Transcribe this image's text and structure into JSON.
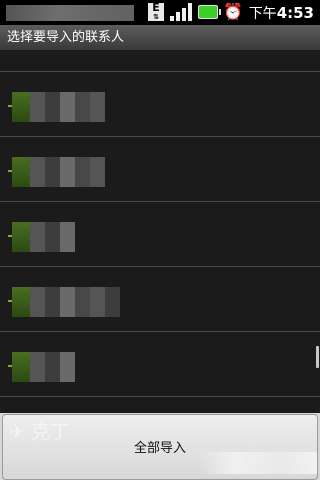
{
  "status_bar": {
    "time_prefix": "下午",
    "time": "4:53",
    "network_letter": "E",
    "icons": [
      "network-e-icon",
      "signal-icon",
      "battery-icon",
      "alarm-icon"
    ]
  },
  "title_bar": {
    "title": "选择要导入的联系人"
  },
  "contacts": [
    {
      "name": "",
      "checked": true
    },
    {
      "name": "",
      "checked": true
    },
    {
      "name": "",
      "checked": true
    },
    {
      "name": "",
      "checked": true
    },
    {
      "name": "",
      "checked": true
    }
  ],
  "bottom": {
    "import_all_label": "全部导入",
    "ghost_text": "✈ 克丁"
  },
  "colors": {
    "check_green": "#6fb13a",
    "battery_green": "#3bd12a",
    "list_bg": "#1b1b1b"
  }
}
